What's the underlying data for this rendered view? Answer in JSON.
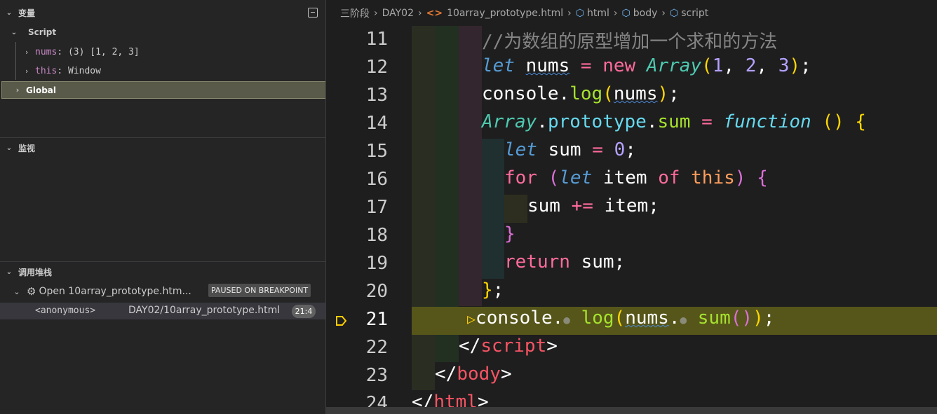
{
  "sidebar": {
    "variables_title": "变量",
    "script_scope": "Script",
    "vars": [
      {
        "name": "nums",
        "value": "(3) [1, 2, 3]"
      },
      {
        "name": "this",
        "value": "Window"
      }
    ],
    "global_scope": "Global",
    "watch_title": "监视",
    "callstack_title": "调用堆栈",
    "thread_label": "Open 10array_prototype.htm...",
    "thread_status": "PAUSED ON BREAKPOINT",
    "frame": {
      "name": "<anonymous>",
      "file": "DAY02/10array_prototype.html",
      "position": "21:4"
    }
  },
  "breadcrumb": {
    "items": [
      "三阶段",
      "DAY02",
      "10array_prototype.html",
      "html",
      "body",
      "script"
    ]
  },
  "editor": {
    "line_numbers": [
      "11",
      "12",
      "13",
      "14",
      "15",
      "16",
      "17",
      "18",
      "19",
      "20",
      "21",
      "22",
      "23",
      "24"
    ],
    "current_line": "21",
    "code": {
      "l11_comment": "//为数组的原型增加一个求和的方法",
      "let": "let",
      "nums": "nums",
      "new": "new",
      "Array": "Array",
      "n1": "1",
      "n2": "2",
      "n3": "3",
      "console": "console",
      "log": "log",
      "prototype": "prototype",
      "sum": "sum",
      "function": "function",
      "zero": "0",
      "for": "for",
      "item": "item",
      "of": "of",
      "this": "this",
      "return": "return",
      "script": "script",
      "body": "body",
      "html": "html"
    }
  },
  "colors": {
    "current_line_highlight": "#56561a",
    "breakpoint_arrow": "#ffcc00"
  }
}
